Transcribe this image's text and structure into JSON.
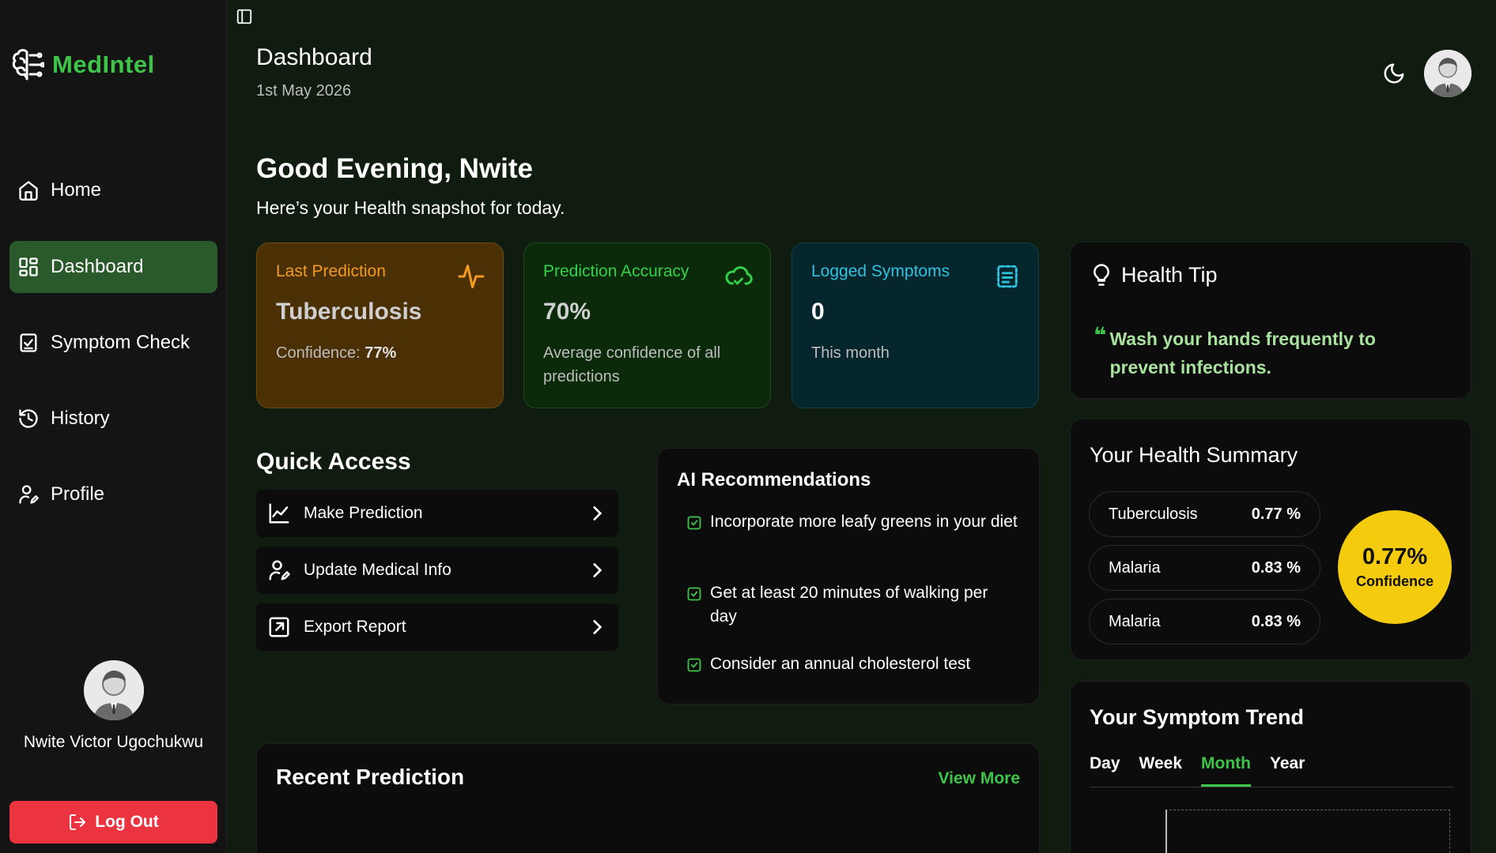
{
  "app": {
    "name": "MedIntel"
  },
  "sidebar": {
    "items": [
      {
        "label": "Home",
        "icon": "home-icon"
      },
      {
        "label": "Dashboard",
        "icon": "dashboard-icon",
        "active": true
      },
      {
        "label": "Symptom Check",
        "icon": "clipboard-check-icon"
      },
      {
        "label": "History",
        "icon": "history-icon"
      },
      {
        "label": "Profile",
        "icon": "user-edit-icon"
      }
    ],
    "user_name": "Nwite Victor Ugochukwu",
    "logout_label": "Log Out"
  },
  "header": {
    "title": "Dashboard",
    "date": "1st May 2026"
  },
  "greeting": {
    "title": "Good Evening, Nwite",
    "subtitle": "Here’s your Health snapshot for today."
  },
  "stats": {
    "last_prediction": {
      "label": "Last Prediction",
      "value": "Tuberculosis",
      "note_prefix": "Confidence: ",
      "note_value": "77%"
    },
    "accuracy": {
      "label": "Prediction Accuracy",
      "value": "70%",
      "note": "Average confidence of all predictions"
    },
    "symptoms": {
      "label": "Logged Symptoms",
      "value": "0",
      "note": "This month"
    }
  },
  "quick_access": {
    "title": "Quick Access",
    "items": [
      {
        "label": "Make Prediction",
        "icon": "chart-line-icon"
      },
      {
        "label": "Update Medical Info",
        "icon": "user-edit-icon"
      },
      {
        "label": "Export Report",
        "icon": "export-icon"
      }
    ]
  },
  "ai": {
    "title": "AI Recommendations",
    "items": [
      "Incorporate more leafy greens in your diet",
      "Get at least 20 minutes of walking per day",
      "Consider an annual cholesterol test"
    ]
  },
  "recent": {
    "title": "Recent Prediction",
    "view_more": "View More"
  },
  "tip": {
    "title": "Health Tip",
    "text": "Wash your hands frequently to prevent infections."
  },
  "summary": {
    "title": "Your Health Summary",
    "rows": [
      {
        "name": "Tuberculosis",
        "value": "0.77 %"
      },
      {
        "name": "Malaria",
        "value": "0.83 %"
      },
      {
        "name": "Malaria",
        "value": "0.83 %"
      }
    ],
    "gauge_value": "0.77%",
    "gauge_label": "Confidence"
  },
  "trend": {
    "title": "Your Symptom Trend",
    "tabs": [
      "Day",
      "Week",
      "Month",
      "Year"
    ],
    "active_tab": "Month"
  },
  "colors": {
    "accent": "#3fc44a",
    "logout": "#ec3340",
    "gauge": "#f5cb0e",
    "orange": "#f39a23",
    "teal": "#2fc2df"
  }
}
